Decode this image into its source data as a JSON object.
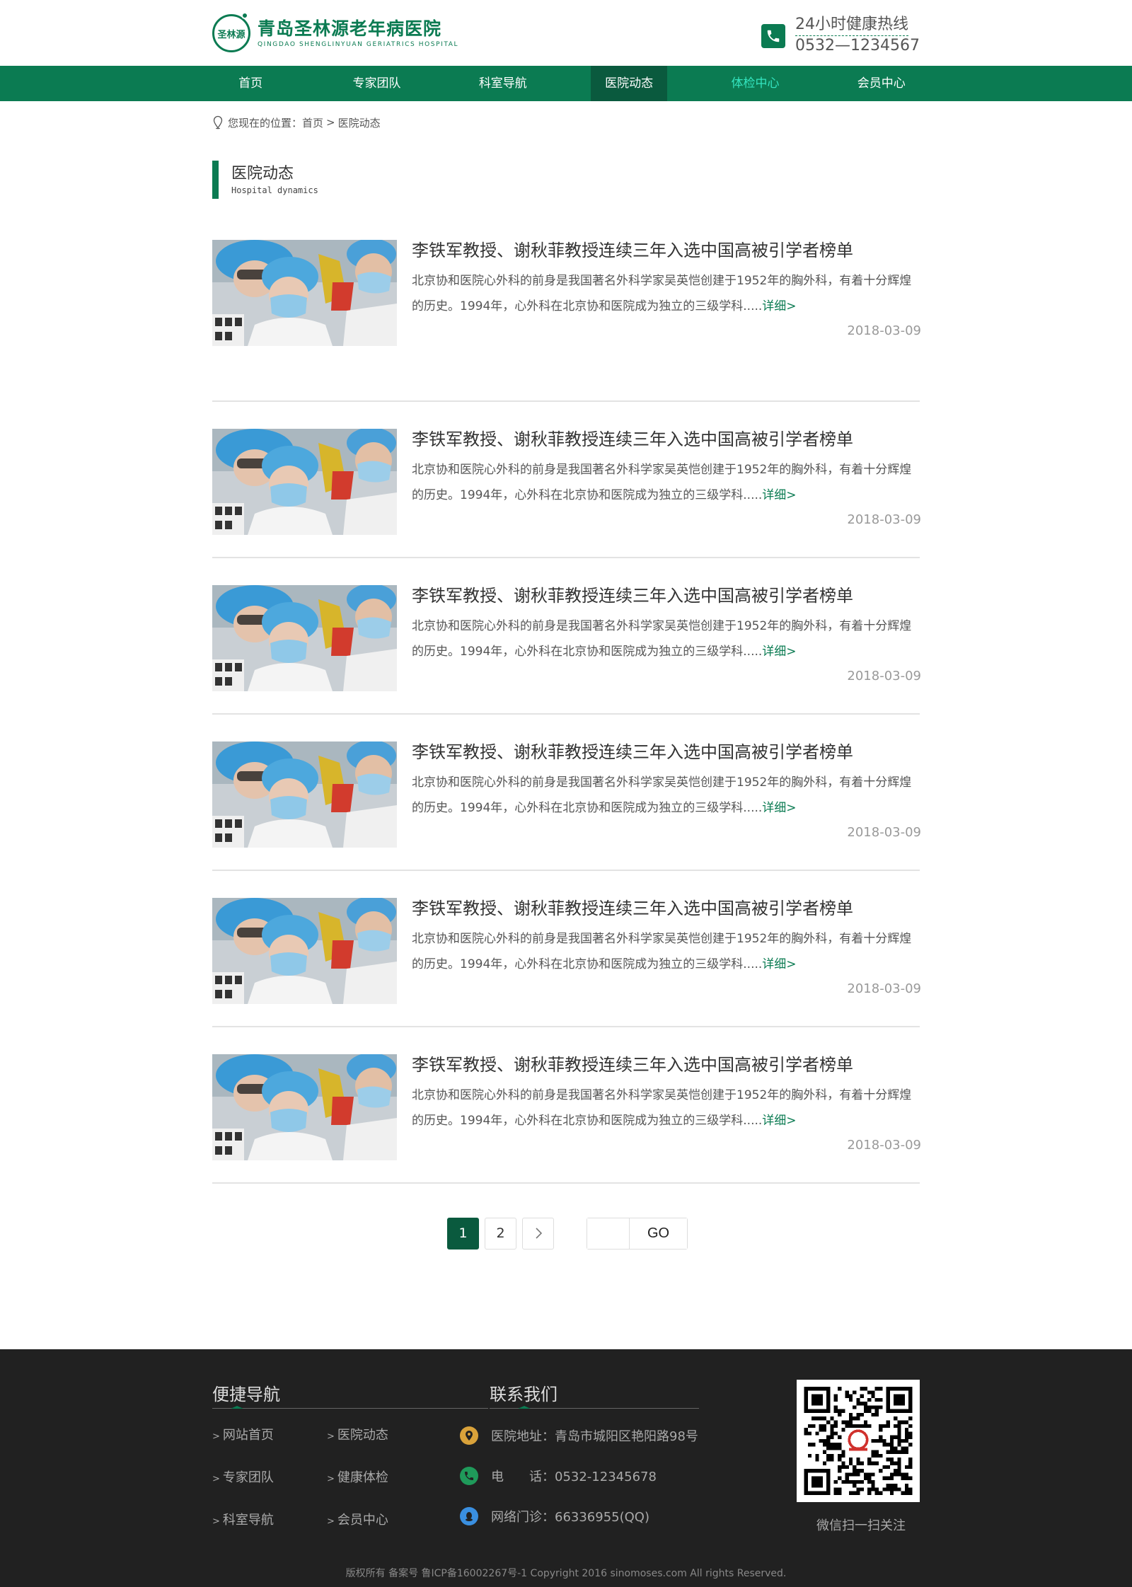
{
  "header": {
    "logo_mark_text": "圣林源",
    "logo_cn": "青岛圣林源老年病医院",
    "logo_en": "QINGDAO SHENGLINYUAN GERIATRICS HOSPITAL",
    "hotline_title": "24小时健康热线",
    "hotline_number": "0532—1234567"
  },
  "nav": {
    "items": [
      {
        "label": "首页"
      },
      {
        "label": "专家团队"
      },
      {
        "label": "科室导航"
      },
      {
        "label": "医院动态"
      },
      {
        "label": "体检中心"
      },
      {
        "label": "会员中心"
      }
    ],
    "active": "医院动态",
    "highlight": "体检中心"
  },
  "breadcrumb": {
    "prefix": "您现在的位置：",
    "home": "首页",
    "separator": ">",
    "current": "医院动态"
  },
  "section": {
    "title_cn": "医院动态",
    "title_en": "Hospital dynamics"
  },
  "news": [
    {
      "title": "李铁军教授、谢秋菲教授连续三年入选中国高被引学者榜单",
      "desc": "北京协和医院心外科的前身是我国著名外科学家吴英恺创建于1952年的胸外科，有着十分辉煌的历史。1994年，心外科在北京协和医院成为独立的三级学科.....",
      "more": "详细>",
      "date": "2018-03-09"
    },
    {
      "title": "李铁军教授、谢秋菲教授连续三年入选中国高被引学者榜单",
      "desc": "北京协和医院心外科的前身是我国著名外科学家吴英恺创建于1952年的胸外科，有着十分辉煌的历史。1994年，心外科在北京协和医院成为独立的三级学科.....",
      "more": "详细>",
      "date": "2018-03-09"
    },
    {
      "title": "李铁军教授、谢秋菲教授连续三年入选中国高被引学者榜单",
      "desc": "北京协和医院心外科的前身是我国著名外科学家吴英恺创建于1952年的胸外科，有着十分辉煌的历史。1994年，心外科在北京协和医院成为独立的三级学科.....",
      "more": "详细>",
      "date": "2018-03-09"
    },
    {
      "title": "李铁军教授、谢秋菲教授连续三年入选中国高被引学者榜单",
      "desc": "北京协和医院心外科的前身是我国著名外科学家吴英恺创建于1952年的胸外科，有着十分辉煌的历史。1994年，心外科在北京协和医院成为独立的三级学科.....",
      "more": "详细>",
      "date": "2018-03-09"
    },
    {
      "title": "李铁军教授、谢秋菲教授连续三年入选中国高被引学者榜单",
      "desc": "北京协和医院心外科的前身是我国著名外科学家吴英恺创建于1952年的胸外科，有着十分辉煌的历史。1994年，心外科在北京协和医院成为独立的三级学科.....",
      "more": "详细>",
      "date": "2018-03-09"
    },
    {
      "title": "李铁军教授、谢秋菲教授连续三年入选中国高被引学者榜单",
      "desc": "北京协和医院心外科的前身是我国著名外科学家吴英恺创建于1952年的胸外科，有着十分辉煌的历史。1994年，心外科在北京协和医院成为独立的三级学科.....",
      "more": "详细>",
      "date": "2018-03-09"
    }
  ],
  "pager": {
    "pages": [
      "1",
      "2"
    ],
    "current": "1",
    "next_icon": "chevron-right-icon",
    "goto_value": "",
    "goto_label": "GO"
  },
  "footer": {
    "nav_title": "便捷导航",
    "links": [
      "网站首页",
      "医院动态",
      "专家团队",
      "健康体检",
      "科室导航",
      "会员中心"
    ],
    "link_prefix": ">",
    "contact_title": "联系我们",
    "address": "医院地址：青岛市城阳区艳阳路98号",
    "phone": "电　　话：0532-12345678",
    "qq": "网络门诊：66336955(QQ)",
    "qr_caption": "微信扫一扫关注",
    "copyright": "版权所有 备案号 鲁ICP备16002267号-1 Copyright 2016 sinomoses.com All rights Reserved."
  },
  "colors": {
    "brand": "#0b7b52",
    "nav_active": "#0a5a3e",
    "nav_highlight": "#34e5c0",
    "footer_bg": "#212121",
    "address_icon": "#d9a23a",
    "phone_icon": "#1f9a5a",
    "qq_icon": "#3a8fe0"
  }
}
